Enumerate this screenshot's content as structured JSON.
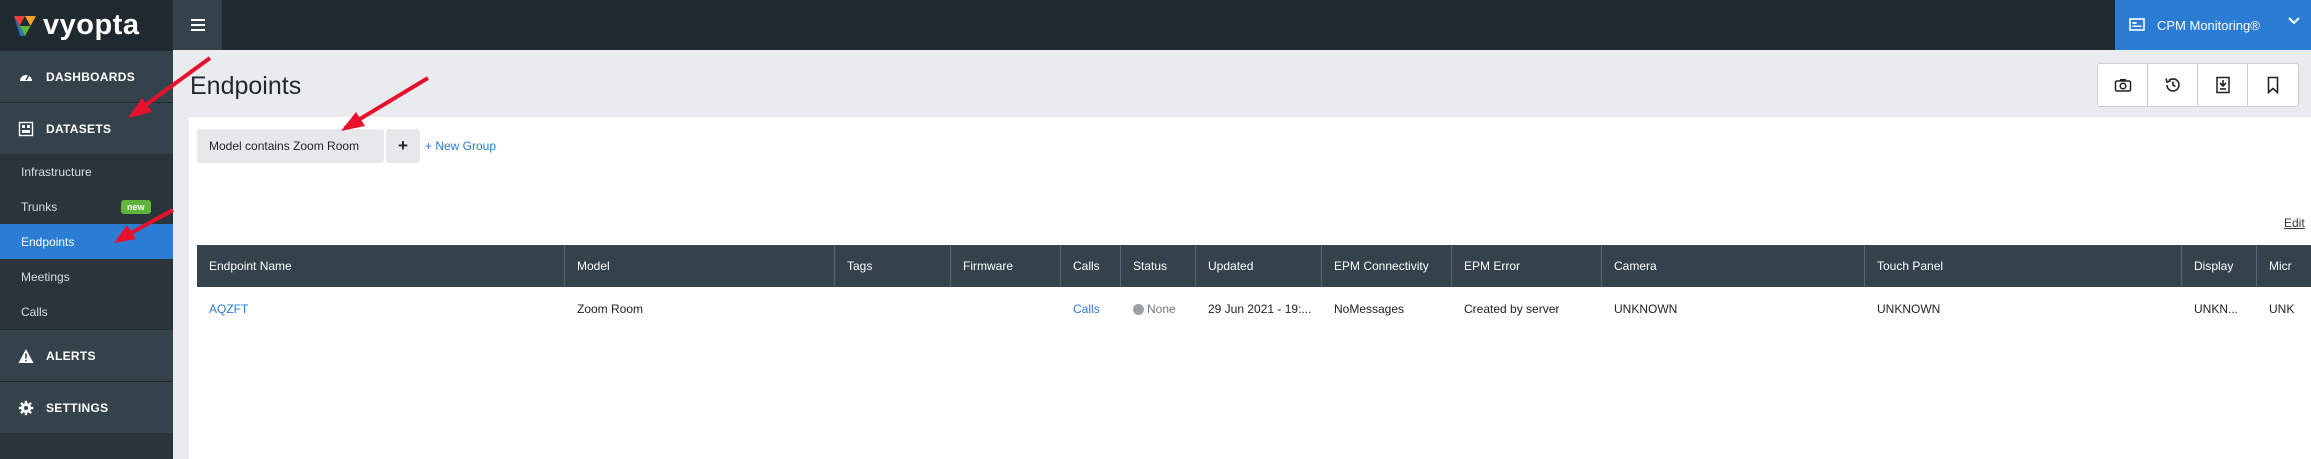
{
  "app": {
    "logo_text": "vyopta",
    "product_switcher": "CPM Monitoring®"
  },
  "sidebar": {
    "sections": [
      {
        "label": "DASHBOARDS",
        "icon": "dashboard-icon"
      },
      {
        "label": "DATASETS",
        "icon": "datasets-icon"
      },
      {
        "label": "ALERTS",
        "icon": "alert-icon"
      },
      {
        "label": "SETTINGS",
        "icon": "gear-icon"
      }
    ],
    "items": [
      {
        "label": "Infrastructure"
      },
      {
        "label": "Trunks",
        "badge": "new"
      },
      {
        "label": "Endpoints",
        "active": true
      },
      {
        "label": "Meetings"
      },
      {
        "label": "Calls"
      }
    ]
  },
  "page": {
    "title": "Endpoints",
    "toolbar_icons": [
      "camera-icon",
      "history-icon",
      "export-icon",
      "bookmark-icon"
    ]
  },
  "filters": {
    "chip": "Model contains Zoom Room",
    "add_label": "+",
    "new_group": "+ New Group",
    "edit": "Edit"
  },
  "table": {
    "columns": [
      "Endpoint Name",
      "Model",
      "Tags",
      "Firmware",
      "Calls",
      "Status",
      "Updated",
      "EPM Connectivity",
      "EPM Error",
      "Camera",
      "Touch Panel",
      "Display",
      "Micr"
    ],
    "rows": [
      {
        "endpoint_name": "AQZFT",
        "model": "Zoom Room",
        "tags": "",
        "firmware": "",
        "calls": "Calls",
        "status": "None",
        "updated": "29 Jun 2021 - 19:...",
        "epm_connectivity": "NoMessages",
        "epm_error": "Created by server",
        "camera": "UNKNOWN",
        "touch_panel": "UNKNOWN",
        "display": "UNKN...",
        "micr": "UNK"
      }
    ]
  },
  "colors": {
    "topbar": "#1f2a30",
    "sidebar": "#2a353b",
    "accent": "#2b7cd3",
    "badge": "#5fb53a",
    "annotation": "#e8112d"
  }
}
